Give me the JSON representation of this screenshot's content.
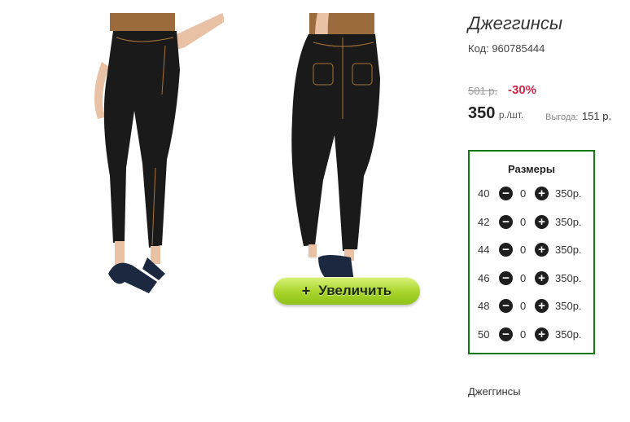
{
  "gallery": {
    "zoom_label": "Увеличить",
    "zoom_icon": "plus-icon",
    "colors": {
      "jeans": "#1a1a1a",
      "stitch": "#a8743a",
      "skin": "#e9c2a6",
      "top": "#9b6b3d",
      "shoe": "#1c2740",
      "button_green": "#a8d42a"
    }
  },
  "product": {
    "title": "Джеггинсы",
    "code": "Код: 960785444",
    "old_price": "501 р.",
    "discount": "-30%",
    "price": "350",
    "price_unit": "р./шт.",
    "savings_label": "Выгода:",
    "savings_value": "151 р.",
    "bottom_name": "Джеггинсы"
  },
  "sizes": {
    "title": "Размеры",
    "border_color": "#107a10",
    "items": [
      {
        "size": "40",
        "qty": "0",
        "price": "350р."
      },
      {
        "size": "42",
        "qty": "0",
        "price": "350р."
      },
      {
        "size": "44",
        "qty": "0",
        "price": "350р."
      },
      {
        "size": "46",
        "qty": "0",
        "price": "350р."
      },
      {
        "size": "48",
        "qty": "0",
        "price": "350р."
      },
      {
        "size": "50",
        "qty": "0",
        "price": "350р."
      }
    ]
  }
}
